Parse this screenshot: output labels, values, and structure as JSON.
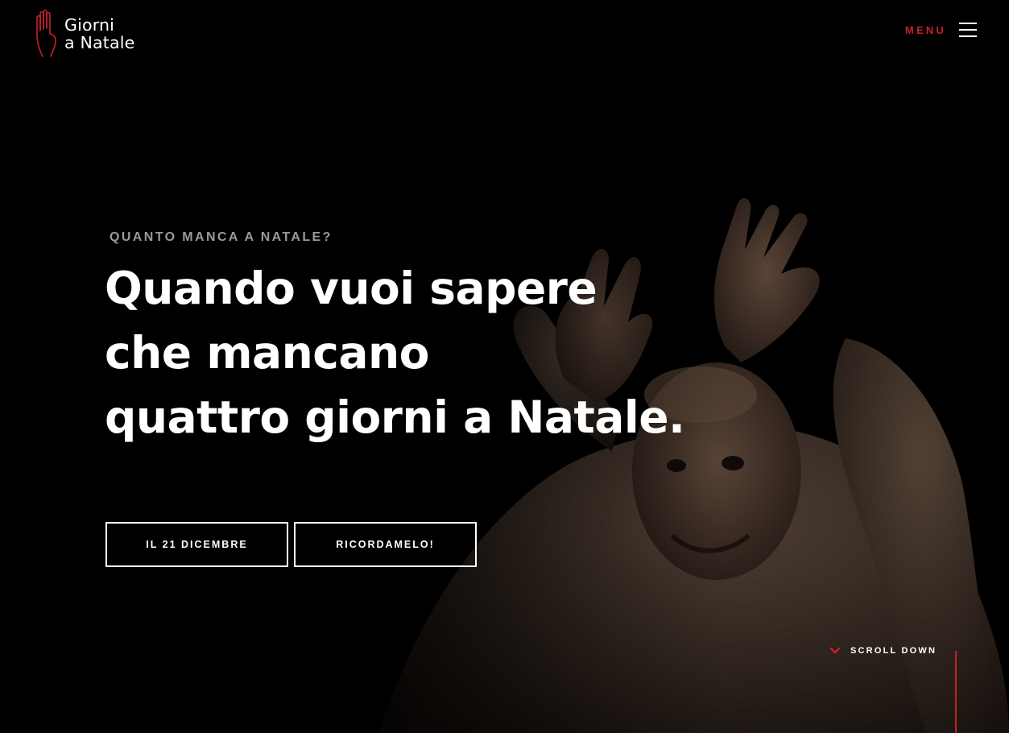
{
  "brand": {
    "line1": "Giorni",
    "line2": "a Natale",
    "accent_color": "#c8202a"
  },
  "nav": {
    "menu_label": "MENU"
  },
  "hero": {
    "eyebrow": "QUANTO MANCA A NATALE?",
    "headline_lines": [
      "Quando vuoi sapere",
      "che mancano",
      "quattro giorni a Natale."
    ],
    "image_desc_icon": "performer-photo",
    "buttons": {
      "date_label": "IL 21 DICEMBRE",
      "remind_label": "RICORDAMELO!"
    }
  },
  "scroll": {
    "label": "SCROLL DOWN",
    "icon": "chevron-down-icon"
  }
}
